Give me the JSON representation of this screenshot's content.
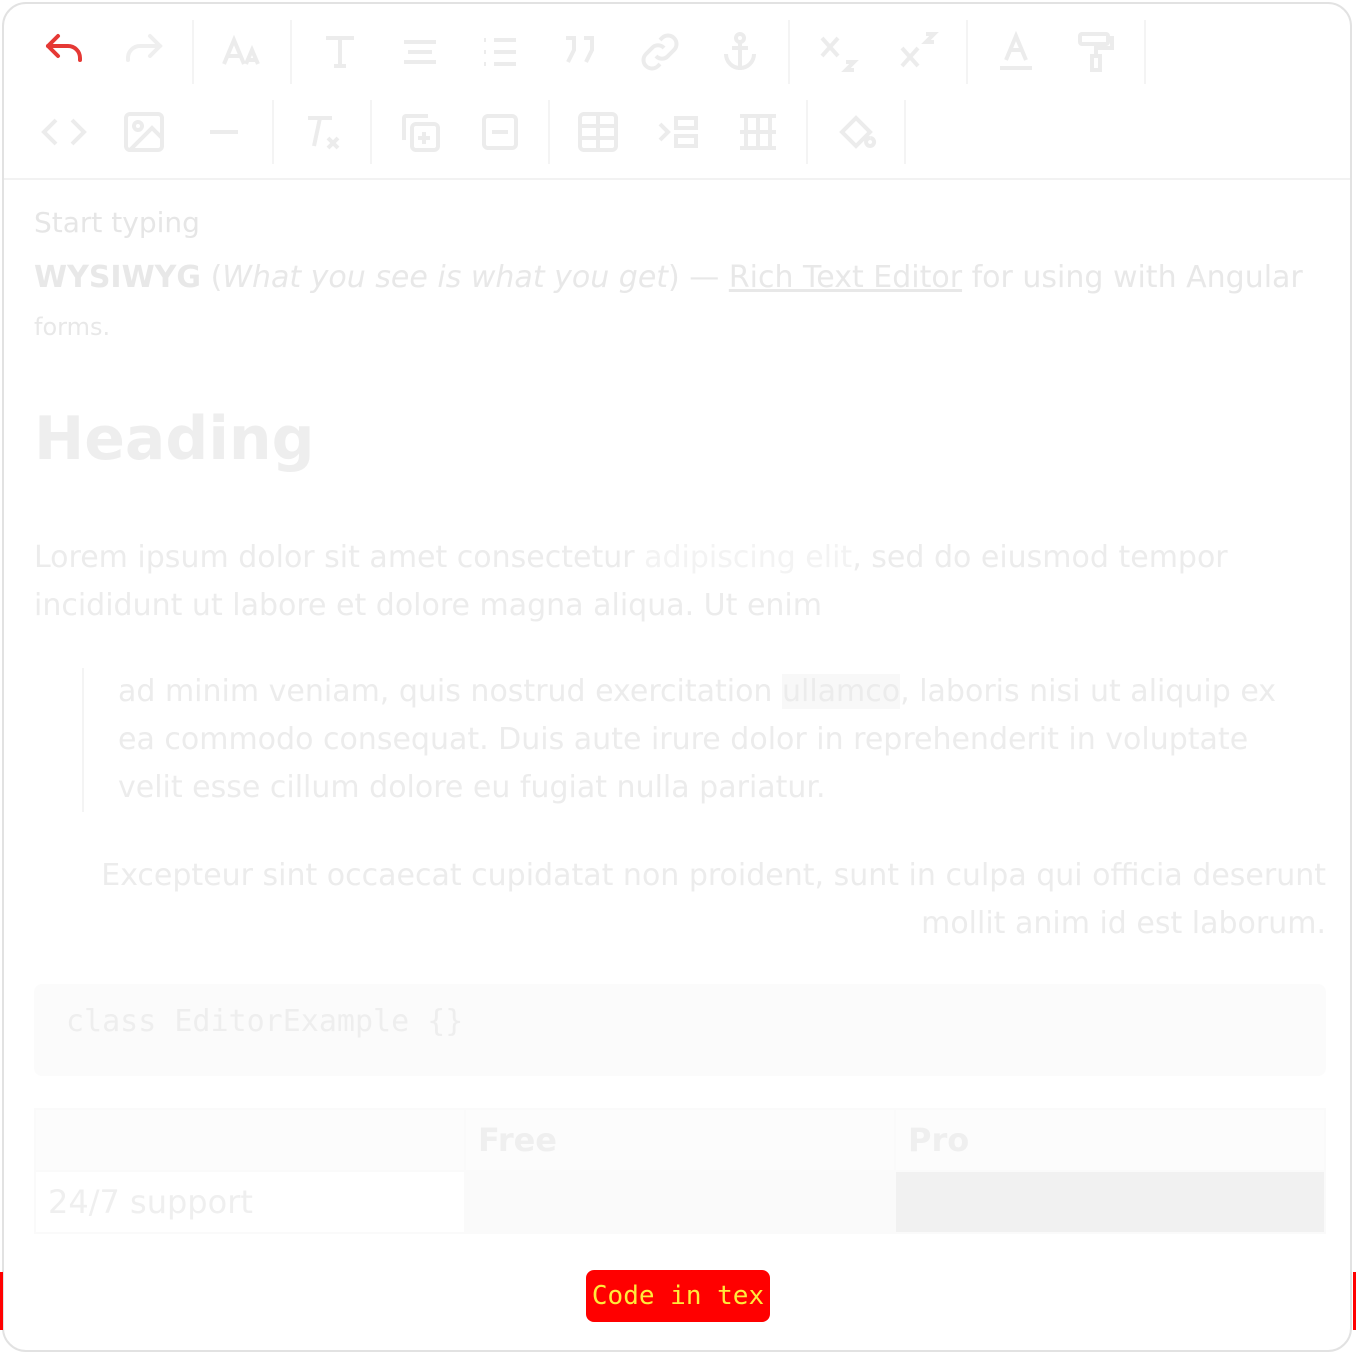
{
  "toolbar": {
    "row1": [
      "undo-icon",
      "redo-icon",
      "font-size-icon",
      "text-style-icon",
      "align-icon",
      "list-icon",
      "quote-icon",
      "link-icon",
      "anchor-icon",
      "subscript-icon",
      "superscript-icon",
      "text-color-icon",
      "paint-roller-icon"
    ],
    "row2": [
      "code-icon",
      "image-icon",
      "horizontal-rule-icon",
      "clear-format-icon",
      "copy-add-icon",
      "remove-icon",
      "table-icon",
      "indent-icon",
      "cell-merge-icon",
      "fill-icon"
    ]
  },
  "content": {
    "placeholder": "Start typing",
    "intro": {
      "bold": "WYSIWYG",
      "open": " (",
      "italic": "What you see is what you get",
      "close": ") — ",
      "link": "Rich Text Editor",
      "tail": " for using with Angular",
      "small": "forms."
    },
    "heading": "Heading",
    "para": {
      "part1": "Lorem ipsum dolor sit amet consectetur ",
      "hl": "adipiscing elit",
      "part2": ", sed do eiusmod tempor incididunt ut labore et dolore magna aliqua. Ut enim"
    },
    "quote": {
      "part1": "ad minim veniam, quis nostrud exercitation ",
      "mark": "ullamco",
      "part2": ", laboris nisi ut aliquip ex ea commodo consequat. Duis aute irure dolor in reprehenderit in voluptate velit esse cillum dolore eu fugiat nulla pariatur."
    },
    "right_para": "Excepteur sint occaecat cupidatat non proident, sunt in culpa qui officia deserunt mollit anim id est laborum.",
    "code": "class EditorExample {}",
    "table": {
      "headers": [
        "",
        "Free",
        "Pro"
      ],
      "rows": [
        [
          "24/7 support",
          "",
          ""
        ]
      ]
    }
  },
  "tag": "Code in tex",
  "colors": {
    "accent": "#ff0000",
    "tag_text": "#ffeb3b",
    "undo": "#e53935"
  }
}
